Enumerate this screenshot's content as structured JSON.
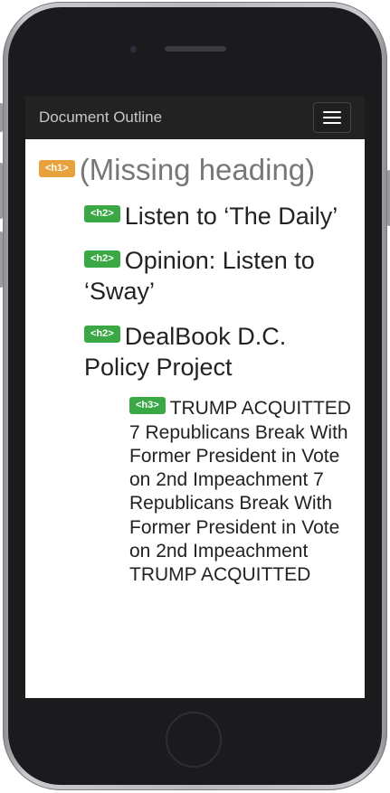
{
  "navbar": {
    "title": "Document Outline"
  },
  "outline": [
    {
      "tag": "<h1>",
      "level": 1,
      "text": "(Missing heading)",
      "badge_color": "#e9a23b"
    },
    {
      "tag": "<h2>",
      "level": 2,
      "text": "Listen to ‘The Daily’",
      "badge_color": "#3aa845"
    },
    {
      "tag": "<h2>",
      "level": 2,
      "text": "Opinion: Listen to ‘Sway’",
      "badge_color": "#3aa845"
    },
    {
      "tag": "<h2>",
      "level": 2,
      "text": "DealBook D.C. Policy Project",
      "badge_color": "#3aa845"
    },
    {
      "tag": "<h3>",
      "level": 3,
      "text": "TRUMP ACQUITTED 7 Republicans Break With Former President in Vote on 2nd Impeachment 7 Republicans Break With Former President in Vote on 2nd Impeachment TRUMP ACQUITTED",
      "badge_color": "#3aa845"
    }
  ]
}
